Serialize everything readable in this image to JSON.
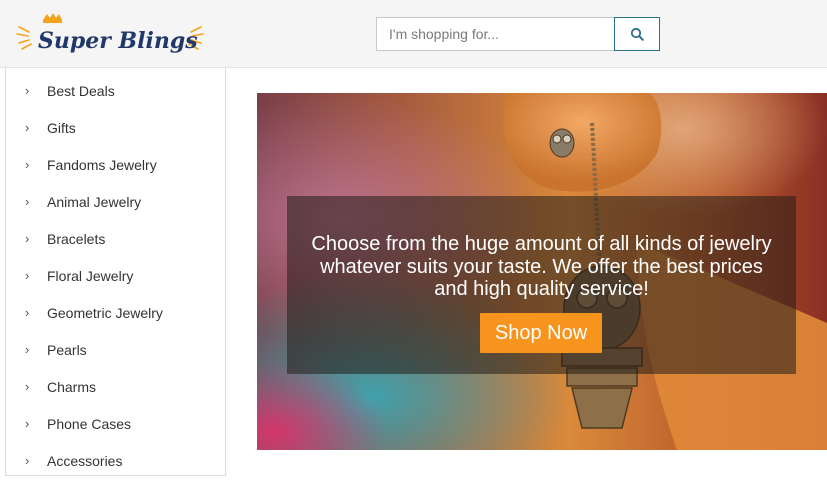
{
  "brand": {
    "name": "Super Blings",
    "accent_color": "#f7a21b",
    "text_color": "#21386b"
  },
  "search": {
    "placeholder": "I'm shopping for...",
    "value": "",
    "icon": "search-icon",
    "border_color": "#2a6f8a"
  },
  "sidebar": {
    "items": [
      {
        "label": "Best Deals"
      },
      {
        "label": "Gifts"
      },
      {
        "label": "Fandoms Jewelry"
      },
      {
        "label": "Animal Jewelry"
      },
      {
        "label": "Bracelets"
      },
      {
        "label": "Floral Jewelry"
      },
      {
        "label": "Geometric Jewelry"
      },
      {
        "label": "Pearls"
      },
      {
        "label": "Charms"
      },
      {
        "label": "Phone Cases"
      },
      {
        "label": "Accessories"
      }
    ],
    "item_icon": "chevron-right-icon"
  },
  "hero": {
    "text": "Choose from the huge amount of all kinds of jewelry whatever suits your taste. We offer the best prices and high quality service!",
    "cta_label": "Shop Now",
    "cta_color": "#f7941d"
  }
}
